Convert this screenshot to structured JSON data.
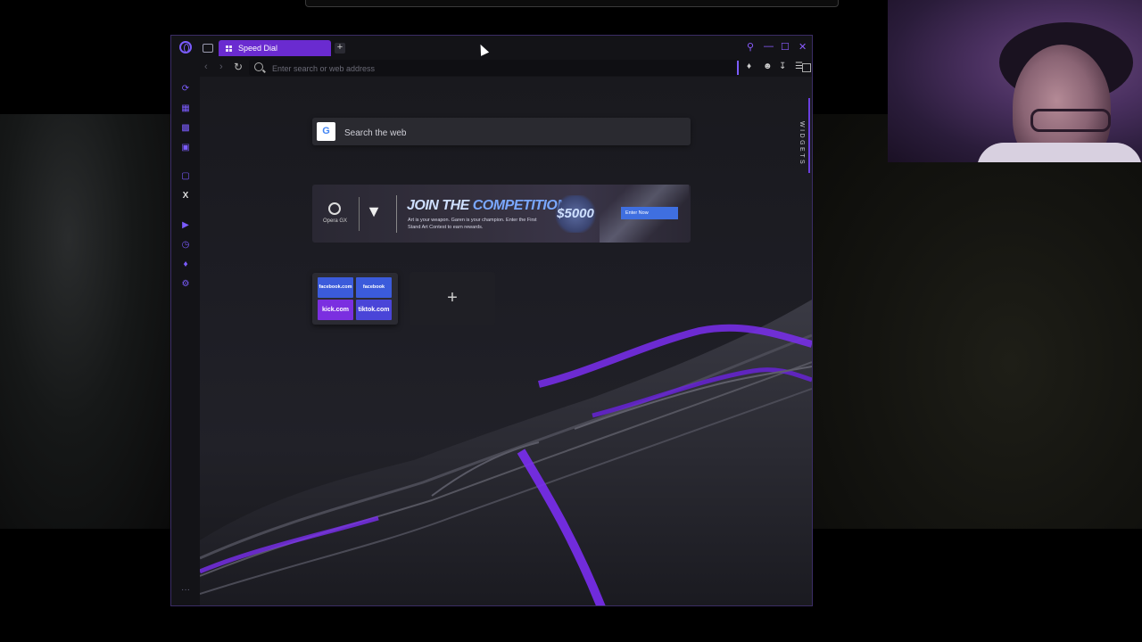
{
  "browser": {
    "tab_label": "Speed Dial",
    "new_tab_label": "+",
    "address_placeholder": "Enter search or web address",
    "window_controls": [
      "search-icon",
      "minimize-icon",
      "maximize-icon",
      "close-icon"
    ],
    "toolbar_icons": [
      "snapshot-icon",
      "extensions-icon",
      "account-icon",
      "download-icon",
      "menu-icon"
    ]
  },
  "sidebar": {
    "items": [
      {
        "icon": "gx-corner-icon"
      },
      {
        "icon": "shop-icon"
      },
      {
        "icon": "games-icon"
      },
      {
        "icon": "messenger-icon"
      },
      {
        "icon": "twitch-icon"
      },
      {
        "icon": "x-icon",
        "label": "X"
      },
      {
        "icon": "player-icon"
      },
      {
        "icon": "history-icon"
      },
      {
        "icon": "extensions-icon"
      },
      {
        "icon": "settings-icon"
      }
    ],
    "bottom_more_label": "···"
  },
  "search": {
    "engine_icon": "G",
    "placeholder": "Search the web"
  },
  "banner": {
    "brand": "Opera GX",
    "headline_1": "JOIN THE",
    "headline_2": "COMPETITION",
    "subtext": "Art is your weapon. Garen is your champion. Enter the First Stand Art Contest to earn rewards.",
    "prize": "$5000",
    "cta": "Enter Now"
  },
  "speed_dial": {
    "tiles": [
      {
        "label": "facebook.com",
        "color": "#3b5bdb"
      },
      {
        "label": "facebook Faceb...",
        "color": "#3b5bdb"
      },
      {
        "label": "kick.com",
        "color": "#7b2fe0"
      },
      {
        "label": "tiktok.com",
        "color": "#4a45d8"
      }
    ],
    "add_label": "+"
  },
  "widgets_label": "WIDGETS",
  "colors": {
    "accent": "#7b5cff",
    "tab_active": "#6a2bd0"
  }
}
